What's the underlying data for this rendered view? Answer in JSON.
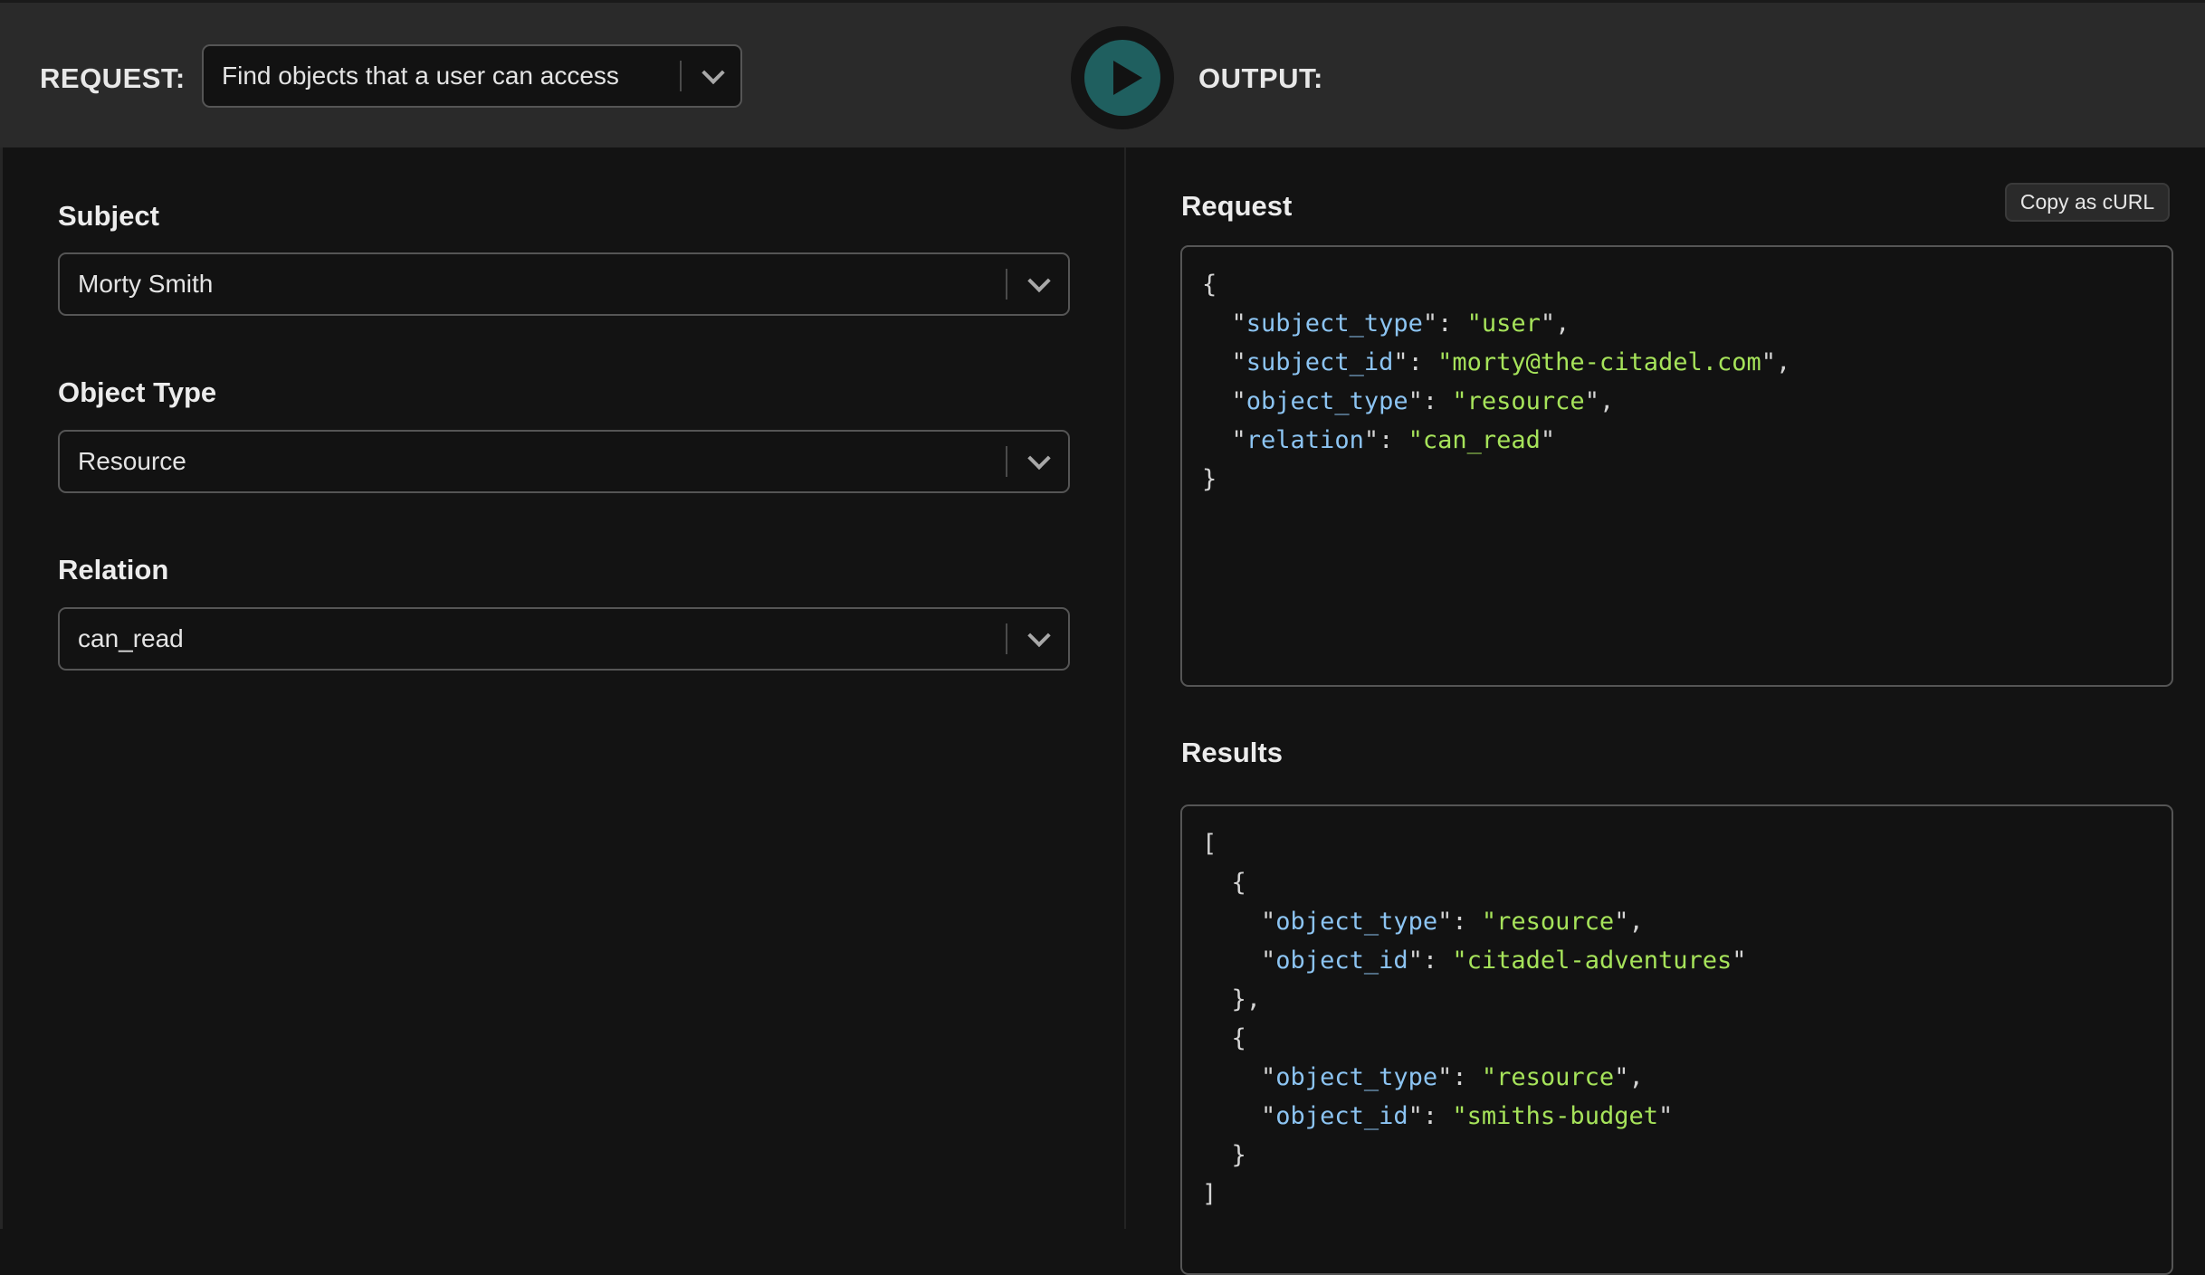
{
  "header": {
    "request_label": "REQUEST:",
    "request_select_value": "Find objects that a user can access",
    "output_label": "OUTPUT:",
    "run_button": "play-icon",
    "accent_color": "#1f5f5f"
  },
  "form": {
    "fields": [
      {
        "label": "Subject",
        "value": "Morty Smith"
      },
      {
        "label": "Object Type",
        "value": "Resource"
      },
      {
        "label": "Relation",
        "value": "can_read"
      }
    ]
  },
  "output": {
    "request_title": "Request",
    "copy_button": "Copy as cURL",
    "request_json": [
      {
        "indent": 0,
        "text": "{"
      },
      {
        "indent": 1,
        "key": "subject_type",
        "value": "user",
        "comma": true
      },
      {
        "indent": 1,
        "key": "subject_id",
        "value": "morty@the-citadel.com",
        "comma": true
      },
      {
        "indent": 1,
        "key": "object_type",
        "value": "resource",
        "comma": true
      },
      {
        "indent": 1,
        "key": "relation",
        "value": "can_read",
        "comma": false
      },
      {
        "indent": 0,
        "text": "}"
      }
    ],
    "results_title": "Results",
    "results_json": [
      {
        "indent": 0,
        "text": "["
      },
      {
        "indent": 1,
        "text": "{"
      },
      {
        "indent": 2,
        "key": "object_type",
        "value": "resource",
        "comma": true
      },
      {
        "indent": 2,
        "key": "object_id",
        "value": "citadel-adventures",
        "comma": false
      },
      {
        "indent": 1,
        "text": "},"
      },
      {
        "indent": 1,
        "text": "{"
      },
      {
        "indent": 2,
        "key": "object_type",
        "value": "resource",
        "comma": true
      },
      {
        "indent": 2,
        "key": "object_id",
        "value": "smiths-budget",
        "comma": false
      },
      {
        "indent": 1,
        "text": "}"
      },
      {
        "indent": 0,
        "text": "]"
      }
    ],
    "key_color": "#8cc4f2",
    "string_color": "#a6e35a"
  }
}
